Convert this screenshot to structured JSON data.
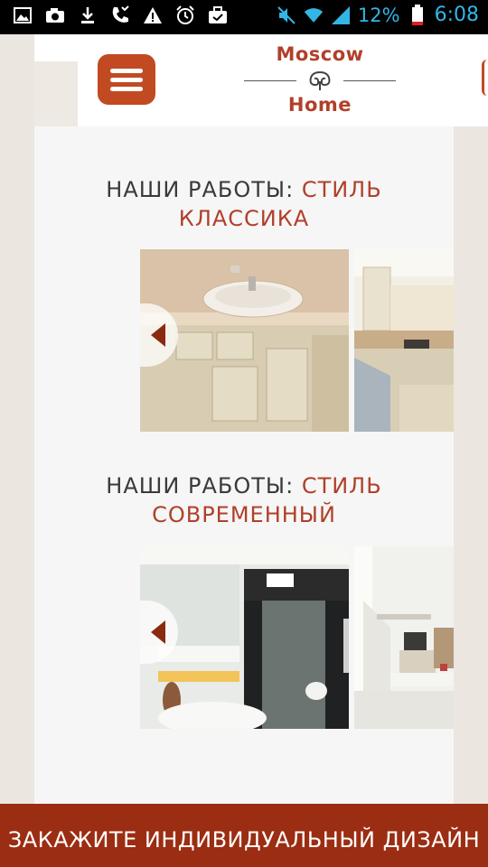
{
  "status_bar": {
    "battery_percent": "12%",
    "time": "6:08",
    "icons": [
      "image-icon",
      "camera-icon",
      "download-icon",
      "missed-call-icon",
      "warning-icon",
      "alarm-icon",
      "briefcase-icon",
      "mute-icon",
      "wifi-icon",
      "signal-icon",
      "battery-icon"
    ]
  },
  "header": {
    "logo_top": "Moscow",
    "logo_bottom": "Home",
    "menu_icon": "hamburger-menu-icon",
    "accent_color": "#c24a22"
  },
  "sections": [
    {
      "title_prefix": "НАШИ РАБОТЫ:",
      "title_accent": "СТИЛЬ",
      "title_line2": "КЛАССИКА",
      "slides": [
        "classic bathroom vanity photo",
        "classic kitchen photo"
      ]
    },
    {
      "title_prefix": "НАШИ РАБОТЫ:",
      "title_accent": "СТИЛЬ",
      "title_line2": "СОВРЕМЕННЫЙ",
      "slides": [
        "modern bathroom photo",
        "modern living room photo"
      ]
    }
  ],
  "footer": {
    "cta_text": "ЗАКАЖИТЕ ИНДИВИДУАЛЬНЫЙ ДИЗАЙН",
    "color": "#9b2d12"
  }
}
